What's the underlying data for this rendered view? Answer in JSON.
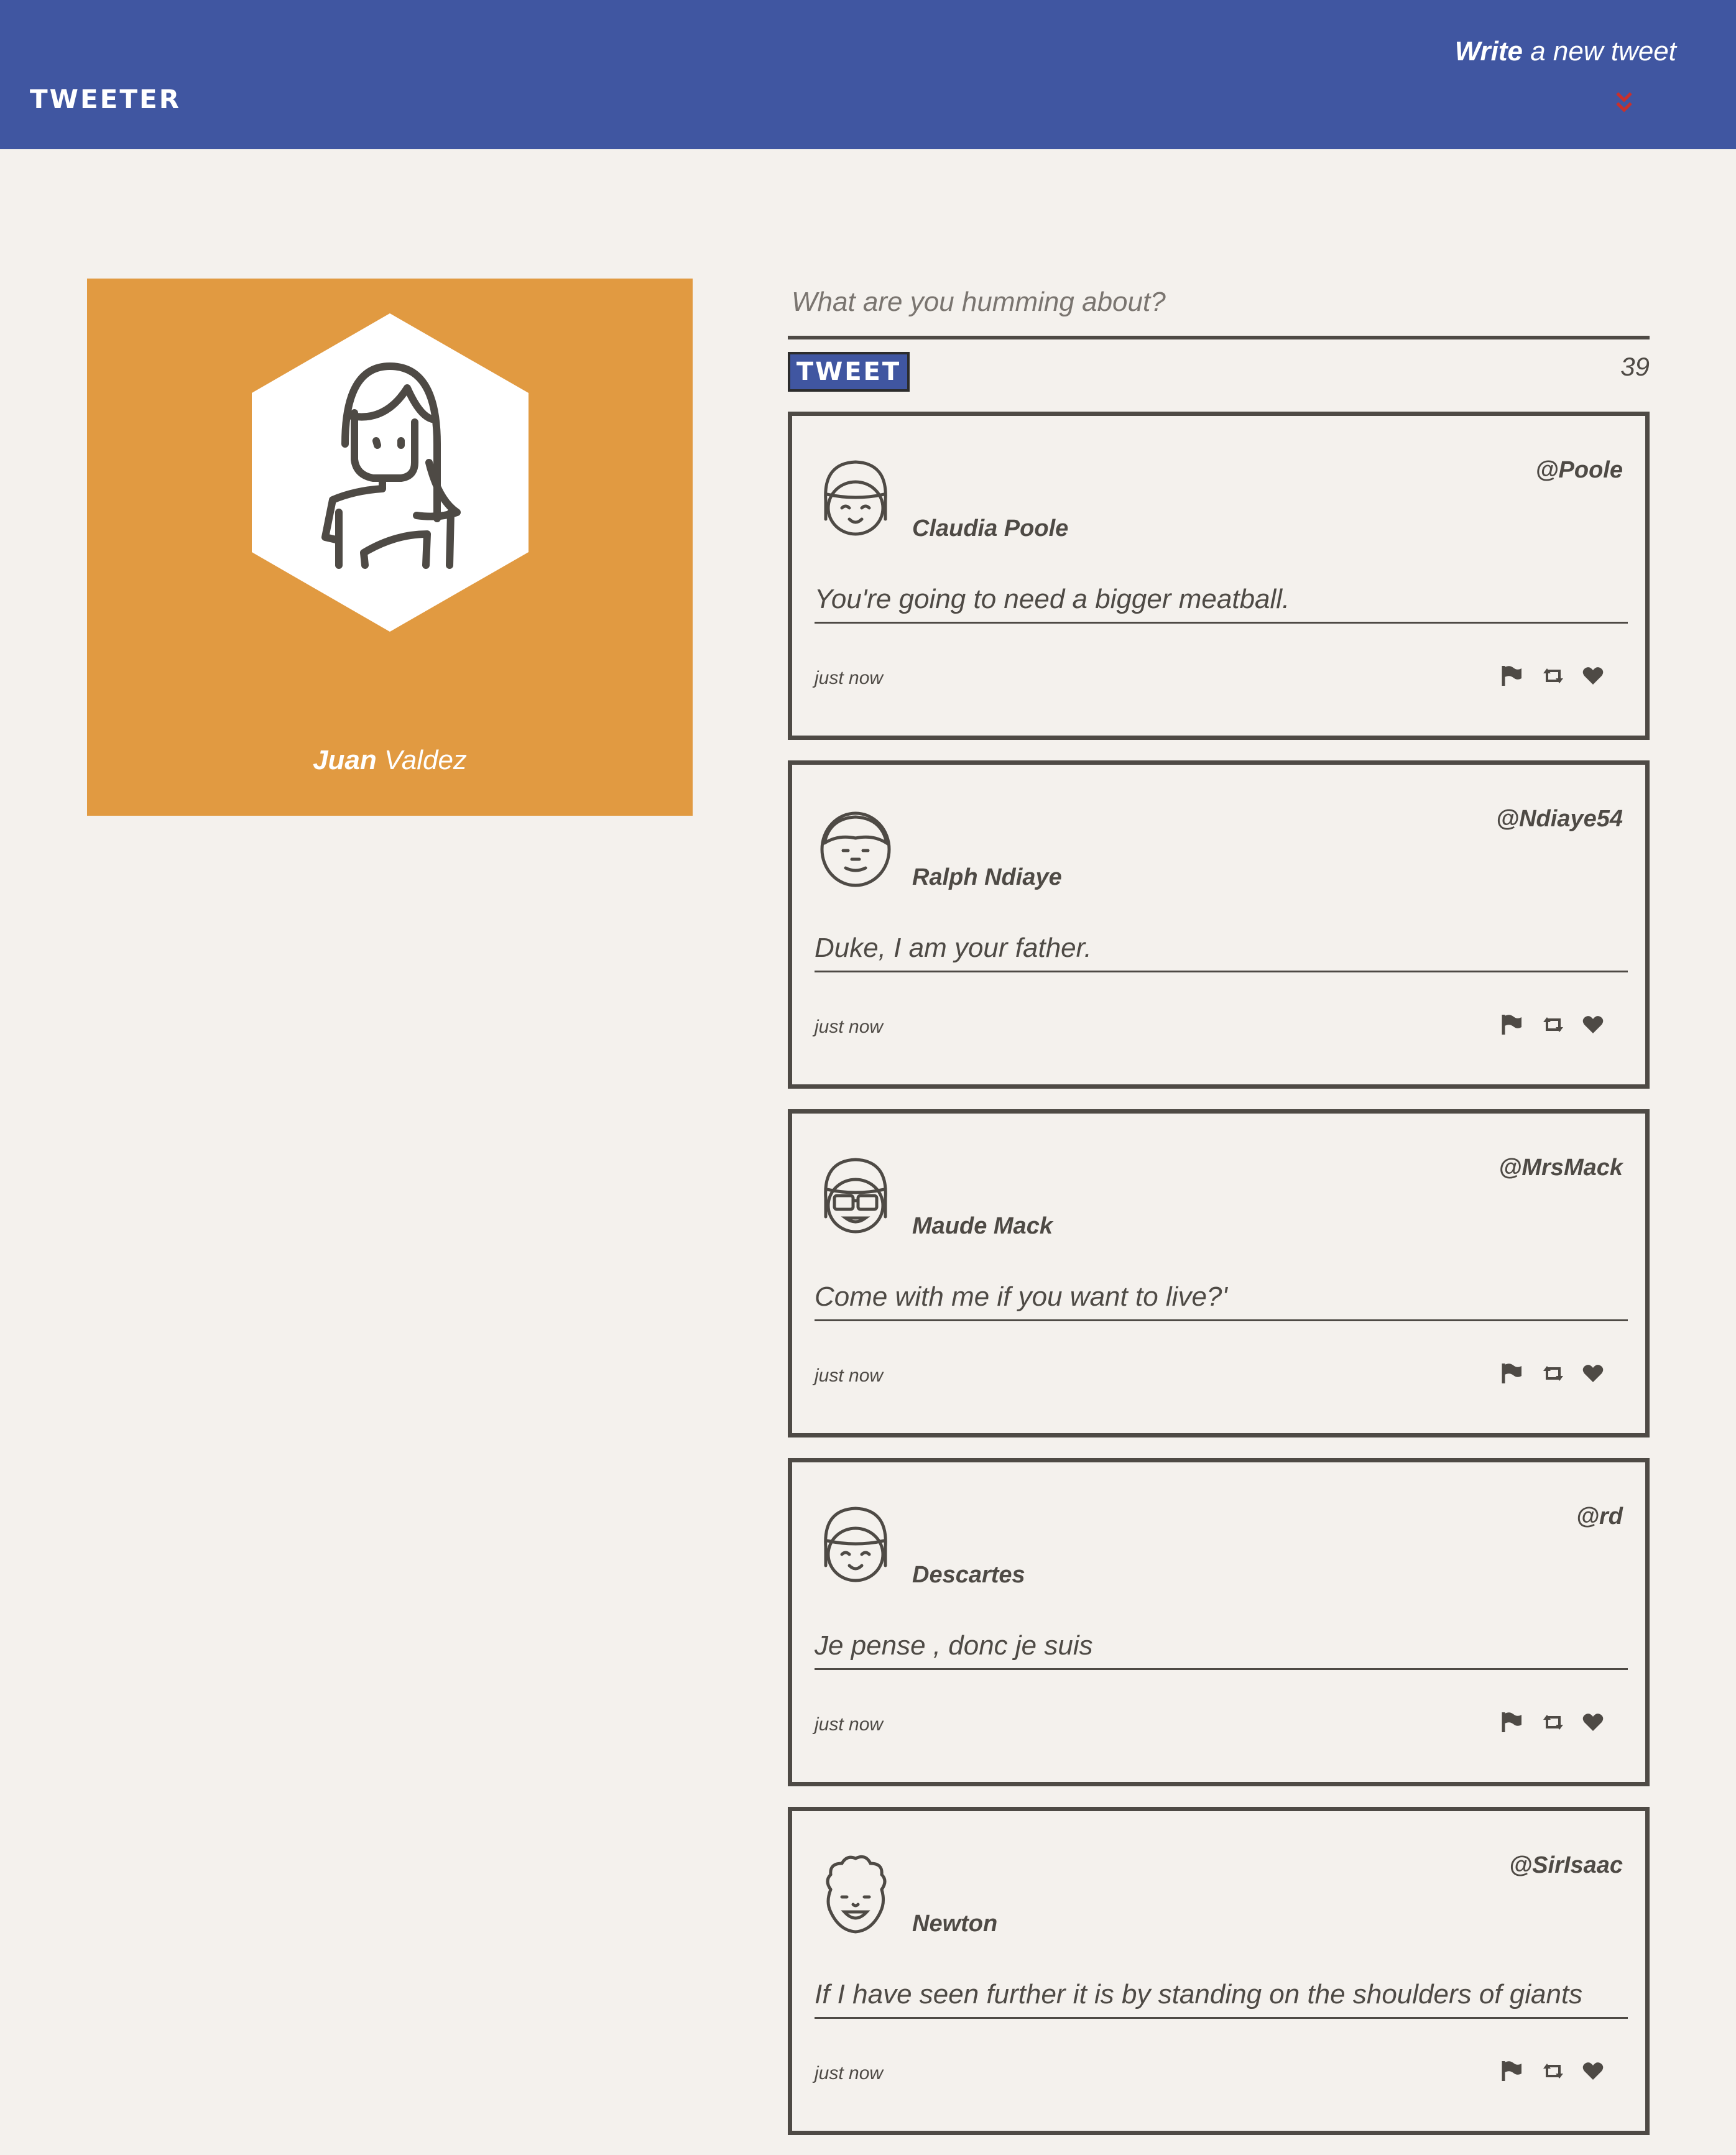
{
  "nav": {
    "logo": "TWEETER",
    "compose_toggle": {
      "bold": "Write",
      "rest": " a new tweet",
      "icon": "double-chevron-down-icon",
      "icon_color": "#c9302c"
    }
  },
  "profile": {
    "first_name": "Juan",
    "last_name": " Valdez",
    "avatar_icon": "woman-avatar-icon",
    "bg_color": "#e19a41"
  },
  "compose": {
    "placeholder": "What are you humming about?",
    "button_label": "TWEET",
    "counter": "39"
  },
  "colors": {
    "nav": "#4056a1",
    "page_bg": "#f4f1ed",
    "text": "#4e4a45"
  },
  "tweets": [
    {
      "handle": "@Poole",
      "name": "Claudia Poole",
      "content": "You're going to need a bigger meatball.",
      "time": "just now",
      "avatar_icon": "girl-bangs-avatar-icon"
    },
    {
      "handle": "@Ndiaye54",
      "name": "Ralph Ndiaye",
      "content": "Duke, I am your father.",
      "time": "just now",
      "avatar_icon": "boy-avatar-icon"
    },
    {
      "handle": "@MrsMack",
      "name": "Maude Mack",
      "content": "Come with me if you want to live?'",
      "time": "just now",
      "avatar_icon": "girl-sunglasses-avatar-icon"
    },
    {
      "handle": "@rd",
      "name": "Descartes",
      "content": "Je pense , donc je suis",
      "time": "just now",
      "avatar_icon": "girl-bangs-avatar-icon"
    },
    {
      "handle": "@SirIsaac",
      "name": "Newton",
      "content": "If I have seen further it is by standing on the shoulders of giants",
      "time": "just now",
      "avatar_icon": "curly-hair-avatar-icon"
    }
  ]
}
